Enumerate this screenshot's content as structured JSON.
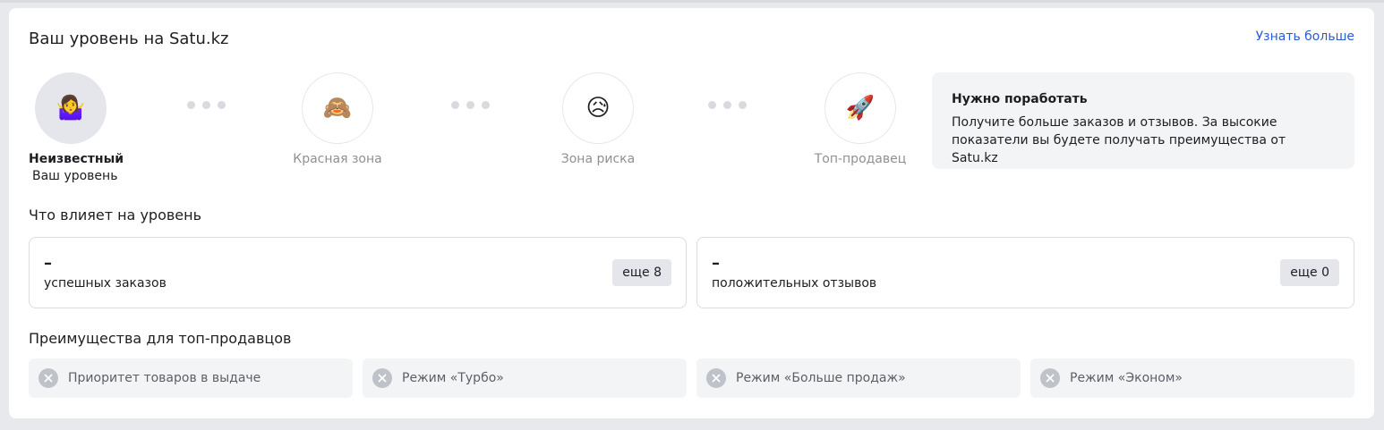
{
  "header": {
    "title": "Ваш уровень на Satu.kz",
    "more_link": "Узнать больше"
  },
  "levels": [
    {
      "emoji": "🤷‍♀️",
      "icon": "shrug-emoji-icon",
      "label": "Неизвестный",
      "sub": "Ваш уровень",
      "active": true
    },
    {
      "emoji": "🙈",
      "icon": "see-no-evil-monkey-icon",
      "label": "Красная зона"
    },
    {
      "emoji": "😥",
      "icon": "sad-face-icon",
      "label": "Зона риска"
    },
    {
      "emoji": "🚀",
      "icon": "rocket-icon",
      "label": "Топ-продавец"
    }
  ],
  "info": {
    "title": "Нужно поработать",
    "text": "Получите больше заказов и отзывов. За высокие показатели вы будете получать преимущества от Satu.kz"
  },
  "factors": {
    "title": "Что влияет на уровень",
    "items": [
      {
        "value": "–",
        "label": "успешных заказов",
        "badge": "еще 8"
      },
      {
        "value": "–",
        "label": "положительных отзывов",
        "badge": "еще 0"
      }
    ]
  },
  "benefits": {
    "title": "Преимущества для топ-продавцов",
    "items": [
      {
        "label": "Приоритет товаров в выдаче"
      },
      {
        "label": "Режим «Турбо»"
      },
      {
        "label": "Режим «Больше продаж»"
      },
      {
        "label": "Режим «Эконом»"
      }
    ]
  },
  "colors": {
    "link": "#2a5bd7",
    "active_circle": "#e4e6eb",
    "box_bg": "#f3f4f6",
    "disabled_icon": "#bfc2c8"
  }
}
